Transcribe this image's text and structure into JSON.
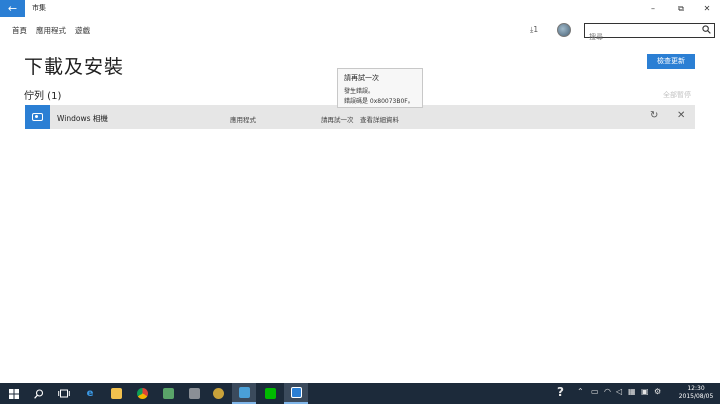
{
  "window": {
    "back_glyph": "←",
    "title": "市集",
    "minimize": "–",
    "maximize": "⧉",
    "close": "✕"
  },
  "nav": {
    "items": [
      "首頁",
      "應用程式",
      "遊戲"
    ]
  },
  "header": {
    "downloads": "⤓1",
    "search_placeholder": "搜尋"
  },
  "main": {
    "title": "下載及安裝",
    "check_updates": "檢查更新",
    "queue_title": "佇列 (1)",
    "pause_all": "全部暫停"
  },
  "queue": [
    {
      "name": "Windows 相機",
      "type": "應用程式",
      "status": "請再試一次",
      "details": "查看詳細資料"
    }
  ],
  "tooltip": {
    "title": "請再試一次",
    "line1": "發生錯誤。",
    "line2": "錯誤碼是 0x80073B0F。"
  },
  "taskbar": {
    "clock_time": "12:30",
    "clock_date": "2015/08/05"
  },
  "colors": {
    "accent": "#2b7fd4",
    "taskbar": "#1c2a3a"
  }
}
